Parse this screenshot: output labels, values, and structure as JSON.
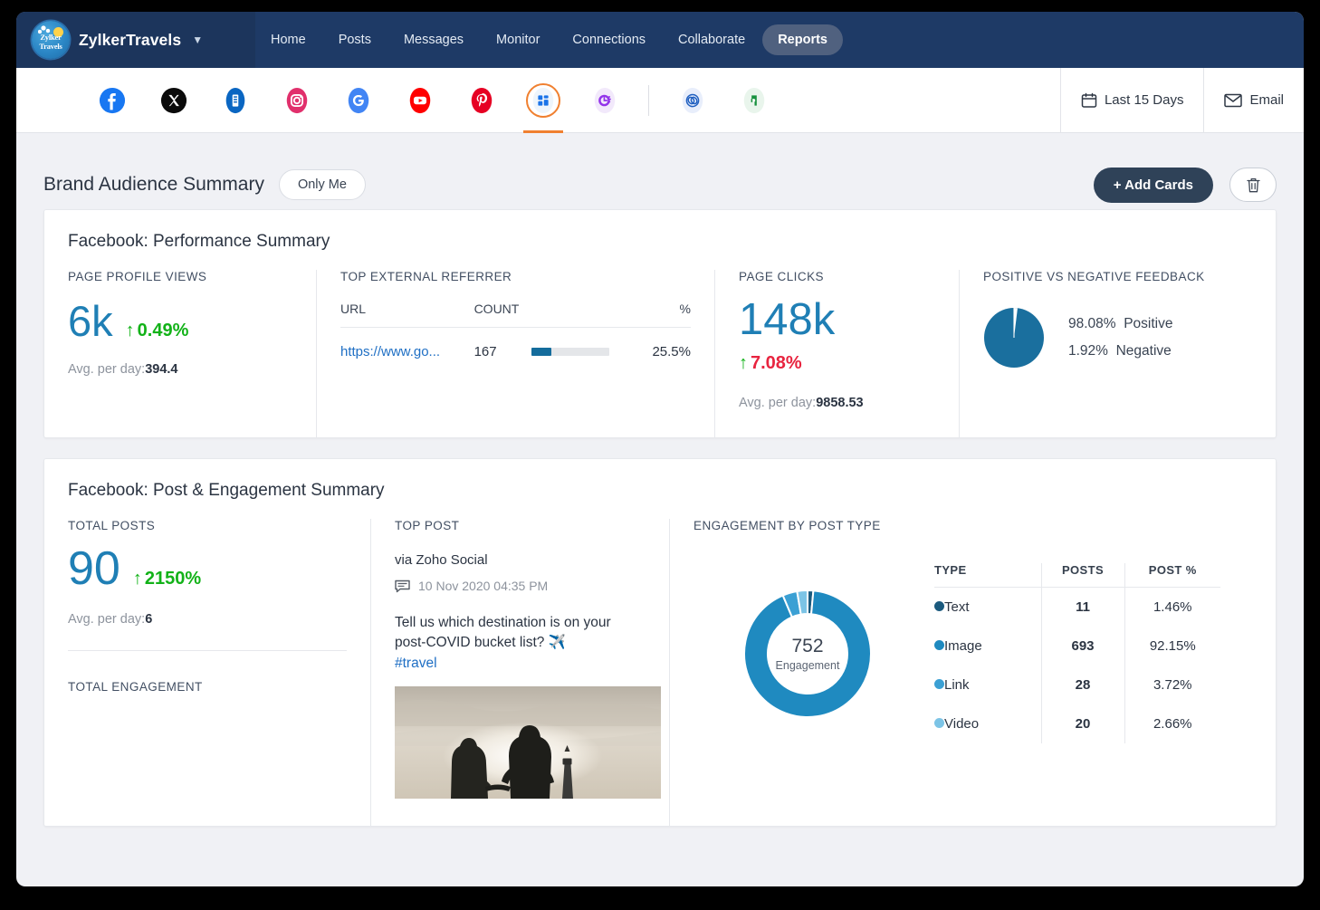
{
  "brand": {
    "name": "ZylkerTravels",
    "logo_text_top": "Zylker",
    "logo_text_bottom": "Travels",
    "caret_icon": "chevron-down-icon"
  },
  "nav": {
    "tabs": [
      {
        "label": "Home",
        "active": false
      },
      {
        "label": "Posts",
        "active": false
      },
      {
        "label": "Messages",
        "active": false
      },
      {
        "label": "Monitor",
        "active": false
      },
      {
        "label": "Connections",
        "active": false
      },
      {
        "label": "Collaborate",
        "active": false
      },
      {
        "label": "Reports",
        "active": true
      }
    ]
  },
  "channels": [
    {
      "name": "facebook-icon",
      "selected": false
    },
    {
      "name": "x-twitter-icon",
      "selected": false
    },
    {
      "name": "linkedin-icon",
      "selected": false
    },
    {
      "name": "instagram-icon",
      "selected": false
    },
    {
      "name": "google-business-icon",
      "selected": false
    },
    {
      "name": "youtube-icon",
      "selected": false
    },
    {
      "name": "pinterest-icon",
      "selected": false
    },
    {
      "name": "dashboard-grid-icon",
      "selected": true
    },
    {
      "name": "scheduler-clock-icon",
      "selected": false
    },
    {
      "name": "zoho-link-icon",
      "selected": false
    },
    {
      "name": "zoho-desk-icon",
      "selected": false
    }
  ],
  "toolbar": {
    "date_range": "Last 15 Days",
    "date_icon": "calendar-icon",
    "email": "Email",
    "email_icon": "envelope-icon"
  },
  "page": {
    "title": "Brand Audience Summary",
    "visibility": "Only Me",
    "add_cards": "+ Add Cards",
    "trash_icon": "trash-icon"
  },
  "card1": {
    "title": "Facebook: Performance Summary",
    "page_profile_views": {
      "label": "PAGE PROFILE VIEWS",
      "value": "6k",
      "delta": "0.49%",
      "delta_arrow": "↑",
      "delta_color": "#12b218",
      "avg_label": "Avg. per day:",
      "avg_value": "394.4"
    },
    "top_external_referrer": {
      "label": "TOP EXTERNAL REFERRER",
      "columns": [
        "URL",
        "COUNT",
        "%"
      ],
      "rows": [
        {
          "url": "https://www.go...",
          "count": "167",
          "percent": "25.5%",
          "bar_pct": 25.5
        }
      ]
    },
    "page_clicks": {
      "label": "PAGE CLICKS",
      "value": "148k",
      "delta": "7.08%",
      "delta_arrow": "↑",
      "delta_color": "#e8243f",
      "avg_label": "Avg. per day:",
      "avg_value": "9858.53"
    },
    "feedback": {
      "label": "POSITIVE VS NEGATIVE FEEDBACK",
      "positive_pct": "98.08%",
      "positive_label": "Positive",
      "negative_pct": "1.92%",
      "negative_label": "Negative",
      "positive_value": 98.08,
      "negative_value": 1.92,
      "positive_color": "#1a6f9e",
      "negative_color": "#ffffff"
    }
  },
  "card2": {
    "title": "Facebook: Post & Engagement Summary",
    "total_posts": {
      "label": "TOTAL POSTS",
      "value": "90",
      "delta": "2150%",
      "delta_arrow": "↑",
      "delta_color": "#12b218",
      "avg_label": "Avg. per day:",
      "avg_value": "6"
    },
    "total_engagement": {
      "label": "TOTAL ENGAGEMENT"
    },
    "top_post": {
      "label": "TOP POST",
      "via": "via Zoho Social",
      "comment_icon": "comment-icon",
      "date": "10 Nov 2020 04:35 PM",
      "text": "Tell us which destination is on your post-COVID bucket list? ✈️",
      "hashtag": "#travel",
      "image_alt": "silhouette-couple-sunset-lighthouse"
    },
    "engagement_by_post_type": {
      "label": "ENGAGEMENT BY POST TYPE",
      "center_value": "752",
      "center_label": "Engagement",
      "columns": [
        "TYPE",
        "POSTS",
        "POST %"
      ],
      "rows": [
        {
          "type": "Text",
          "posts": "11",
          "post_pct": "1.46%",
          "color": "#1b5a7e",
          "value": 1.46
        },
        {
          "type": "Image",
          "posts": "693",
          "post_pct": "92.15%",
          "color": "#1f8ac0",
          "value": 92.15
        },
        {
          "type": "Link",
          "posts": "28",
          "post_pct": "3.72%",
          "color": "#3ba0d4",
          "value": 3.72
        },
        {
          "type": "Video",
          "posts": "20",
          "post_pct": "2.66%",
          "color": "#7cc4e6",
          "value": 2.66
        }
      ]
    }
  },
  "chart_data": [
    {
      "type": "pie",
      "title": "POSITIVE VS NEGATIVE FEEDBACK",
      "categories": [
        "Positive",
        "Negative"
      ],
      "values": [
        98.08,
        1.92
      ],
      "colors": [
        "#1a6f9e",
        "#ffffff"
      ],
      "legend_position": "right",
      "labels": [
        "98.08% Positive",
        "1.92% Negative"
      ]
    },
    {
      "type": "pie",
      "subtype": "donut",
      "title": "ENGAGEMENT BY POST TYPE",
      "categories": [
        "Text",
        "Image",
        "Link",
        "Video"
      ],
      "values": [
        1.46,
        92.15,
        3.72,
        2.66
      ],
      "counts": [
        11,
        693,
        28,
        20
      ],
      "colors": [
        "#1b5a7e",
        "#1f8ac0",
        "#3ba0d4",
        "#7cc4e6"
      ],
      "center_value": 752,
      "center_label": "Engagement",
      "legend_position": "right",
      "grid": false
    },
    {
      "type": "bar",
      "subtype": "progress",
      "title": "TOP EXTERNAL REFERRER",
      "categories": [
        "https://www.go..."
      ],
      "values": [
        25.5
      ],
      "counts": [
        167
      ],
      "ylabel": "%",
      "ylim": [
        0,
        100
      ],
      "grid": false
    }
  ]
}
